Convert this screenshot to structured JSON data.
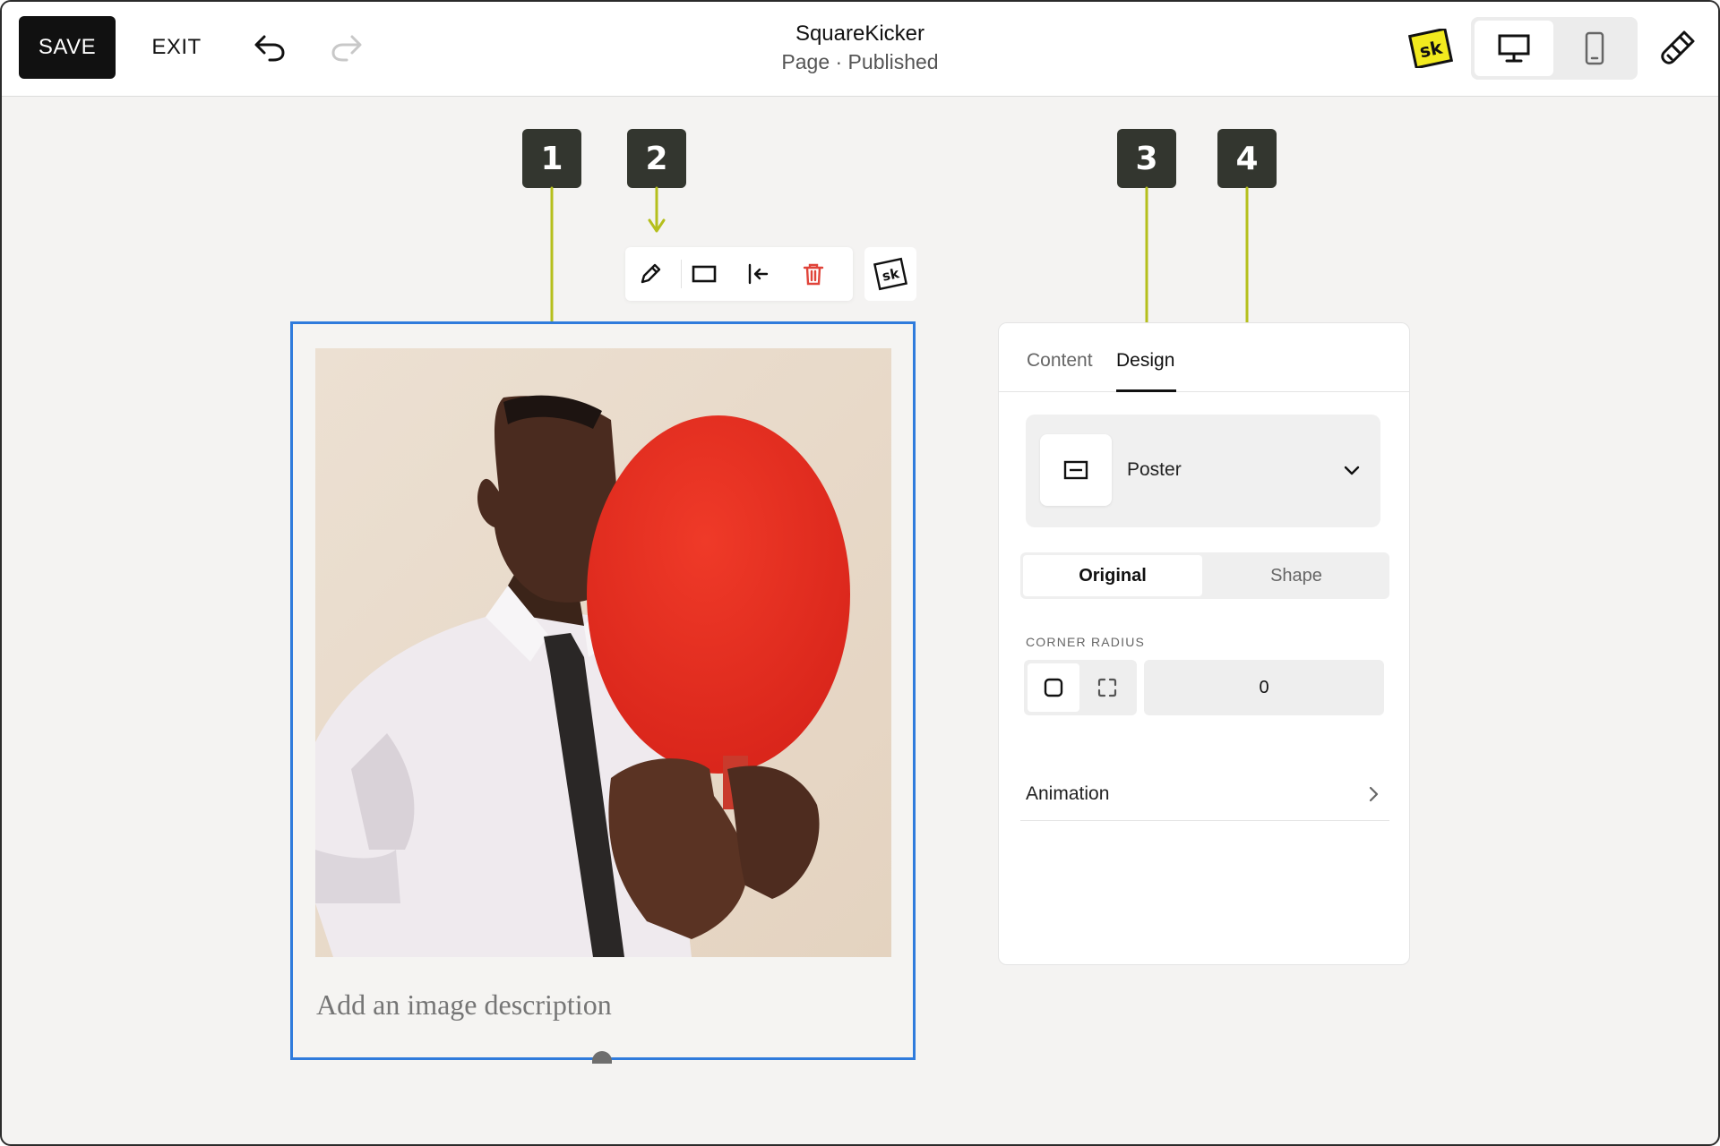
{
  "header": {
    "save_label": "SAVE",
    "exit_label": "EXIT",
    "site_title": "SquareKicker",
    "page_status": "Page · Published",
    "sk_logo_text": "sk"
  },
  "annotations": {
    "badges": [
      "1",
      "2",
      "3",
      "4"
    ],
    "color": "#b5bf1c",
    "badge_color": "#33362f"
  },
  "selection_color": "#2f7bdc",
  "image_block": {
    "caption_placeholder": "Add an image description"
  },
  "toolbar": {
    "tools": [
      "pencil-icon",
      "frame-icon",
      "align-left-icon",
      "trash-icon"
    ],
    "sk_tool_text": "sk"
  },
  "design_panel": {
    "tabs": {
      "content": "Content",
      "design": "Design",
      "active": "Design"
    },
    "layout": {
      "selected": "Poster"
    },
    "crop": {
      "options": [
        "Original",
        "Shape"
      ],
      "active": "Original"
    },
    "corner_radius": {
      "label": "CORNER RADIUS",
      "value": "0"
    },
    "animation_label": "Animation"
  }
}
